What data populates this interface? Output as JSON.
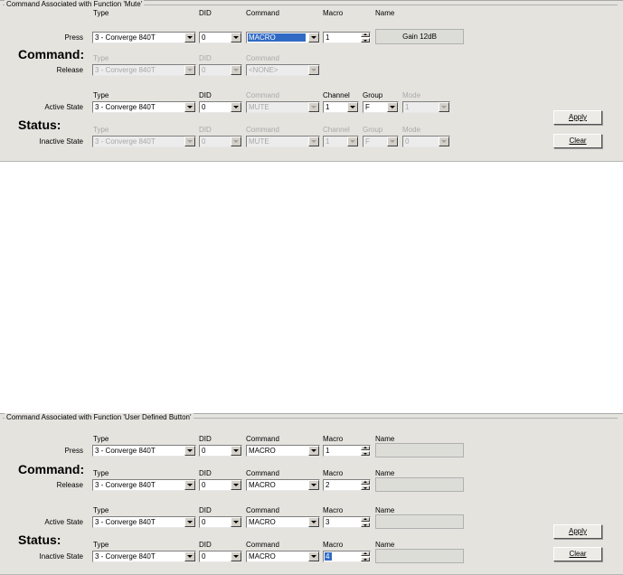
{
  "panel1": {
    "title": "Command Associated with Function 'Mute'",
    "col_type": "Type",
    "col_did": "DID",
    "col_command": "Command",
    "col_macro": "Macro",
    "col_name": "Name",
    "col_channel": "Channel",
    "col_group": "Group",
    "col_mode": "Mode",
    "section_command": "Command:",
    "section_status": "Status:",
    "row_press": "Press",
    "row_release": "Release",
    "row_active": "Active State",
    "row_inactive": "Inactive State",
    "press": {
      "type": "3 - Converge 840T",
      "did": "0",
      "command": "MACRO",
      "macro": "1",
      "name": "Gain 12dB"
    },
    "release": {
      "type": "3 - Converge 840T",
      "did": "0",
      "command": "<NONE>"
    },
    "active": {
      "type": "3 - Converge 840T",
      "did": "0",
      "command": "MUTE",
      "channel": "1",
      "group": "F",
      "mode": "1"
    },
    "inactive": {
      "type": "3 - Converge 840T",
      "did": "0",
      "command": "MUTE",
      "channel": "1",
      "group": "F",
      "mode": "0"
    },
    "apply_label": "Apply",
    "clear_label": "Clear"
  },
  "panel2": {
    "title": "Command Associated with Function 'User Defined Button'",
    "col_type": "Type",
    "col_did": "DID",
    "col_command": "Command",
    "col_macro": "Macro",
    "col_name": "Name",
    "section_command": "Command:",
    "section_status": "Status:",
    "row_press": "Press",
    "row_release": "Release",
    "row_active": "Active State",
    "row_inactive": "Inactive State",
    "press": {
      "type": "3 - Converge 840T",
      "did": "0",
      "command": "MACRO",
      "macro": "1",
      "name": ""
    },
    "release": {
      "type": "3 - Converge 840T",
      "did": "0",
      "command": "MACRO",
      "macro": "2",
      "name": ""
    },
    "active": {
      "type": "3 - Converge 840T",
      "did": "0",
      "command": "MACRO",
      "macro": "3",
      "name": ""
    },
    "inactive": {
      "type": "3 - Converge 840T",
      "did": "0",
      "command": "MACRO",
      "macro": "4",
      "name": ""
    },
    "apply_label": "Apply",
    "clear_label": "Clear"
  }
}
